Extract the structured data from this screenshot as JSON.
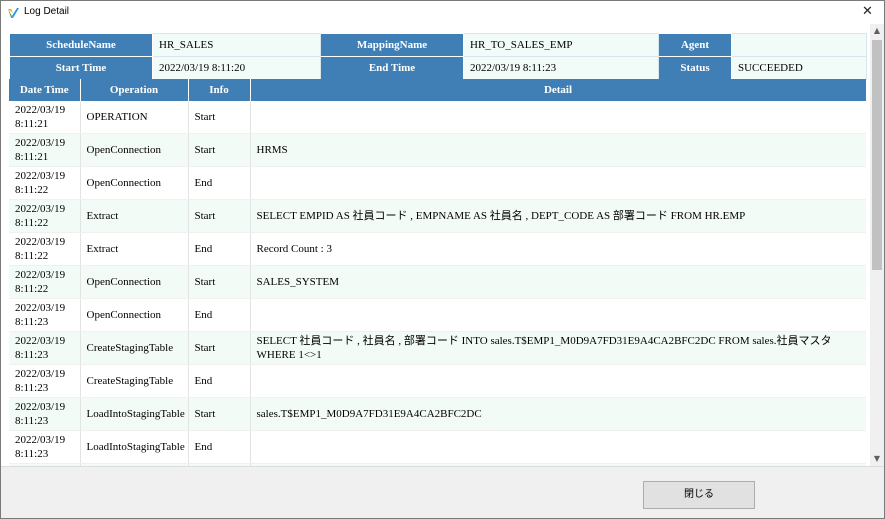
{
  "window": {
    "title": "Log Detail",
    "close_glyph": "✕"
  },
  "header": {
    "schedule_name_label": "ScheduleName",
    "schedule_name": "HR_SALES",
    "mapping_name_label": "MappingName",
    "mapping_name": "HR_TO_SALES_EMP",
    "agent_label": "Agent",
    "agent": "",
    "start_time_label": "Start Time",
    "start_time": "2022/03/19 8:11:20",
    "end_time_label": "End Time",
    "end_time": "2022/03/19 8:11:23",
    "status_label": "Status",
    "status": "SUCCEEDED"
  },
  "grid": {
    "columns": [
      "Date Time",
      "Operation",
      "Info",
      "Detail"
    ],
    "rows": [
      {
        "datetime": "2022/03/19\n8:11:21",
        "operation": "OPERATION",
        "info": "Start",
        "detail": ""
      },
      {
        "datetime": "2022/03/19\n8:11:21",
        "operation": "OpenConnection",
        "info": "Start",
        "detail": "HRMS"
      },
      {
        "datetime": "2022/03/19\n8:11:22",
        "operation": "OpenConnection",
        "info": "End",
        "detail": ""
      },
      {
        "datetime": "2022/03/19\n8:11:22",
        "operation": "Extract",
        "info": "Start",
        "detail": "SELECT EMPID AS 社員コード , EMPNAME AS 社員名 , DEPT_CODE AS 部署コード FROM HR.EMP"
      },
      {
        "datetime": "2022/03/19\n8:11:22",
        "operation": "Extract",
        "info": "End",
        "detail": "Record Count : 3"
      },
      {
        "datetime": "2022/03/19\n8:11:22",
        "operation": "OpenConnection",
        "info": "Start",
        "detail": "SALES_SYSTEM"
      },
      {
        "datetime": "2022/03/19\n8:11:23",
        "operation": "OpenConnection",
        "info": "End",
        "detail": ""
      },
      {
        "datetime": "2022/03/19\n8:11:23",
        "operation": "CreateStagingTable",
        "info": "Start",
        "detail": "SELECT 社員コード , 社員名 , 部署コード INTO sales.T$EMP1_M0D9A7FD31E9A4CA2BFC2DC FROM sales.社員マスタ WHERE 1<>1"
      },
      {
        "datetime": "2022/03/19\n8:11:23",
        "operation": "CreateStagingTable",
        "info": "End",
        "detail": ""
      },
      {
        "datetime": "2022/03/19\n8:11:23",
        "operation": "LoadIntoStagingTable",
        "info": "Start",
        "detail": "sales.T$EMP1_M0D9A7FD31E9A4CA2BFC2DC"
      },
      {
        "datetime": "2022/03/19\n8:11:23",
        "operation": "LoadIntoStagingTable",
        "info": "End",
        "detail": ""
      },
      {
        "datetime": "",
        "operation": "",
        "info": "",
        "detail": ""
      }
    ]
  },
  "footer": {
    "close_button_label": "閉じる"
  },
  "colors": {
    "header_blue": "#3f7fb6",
    "row_alt": "#f3fbf7"
  }
}
